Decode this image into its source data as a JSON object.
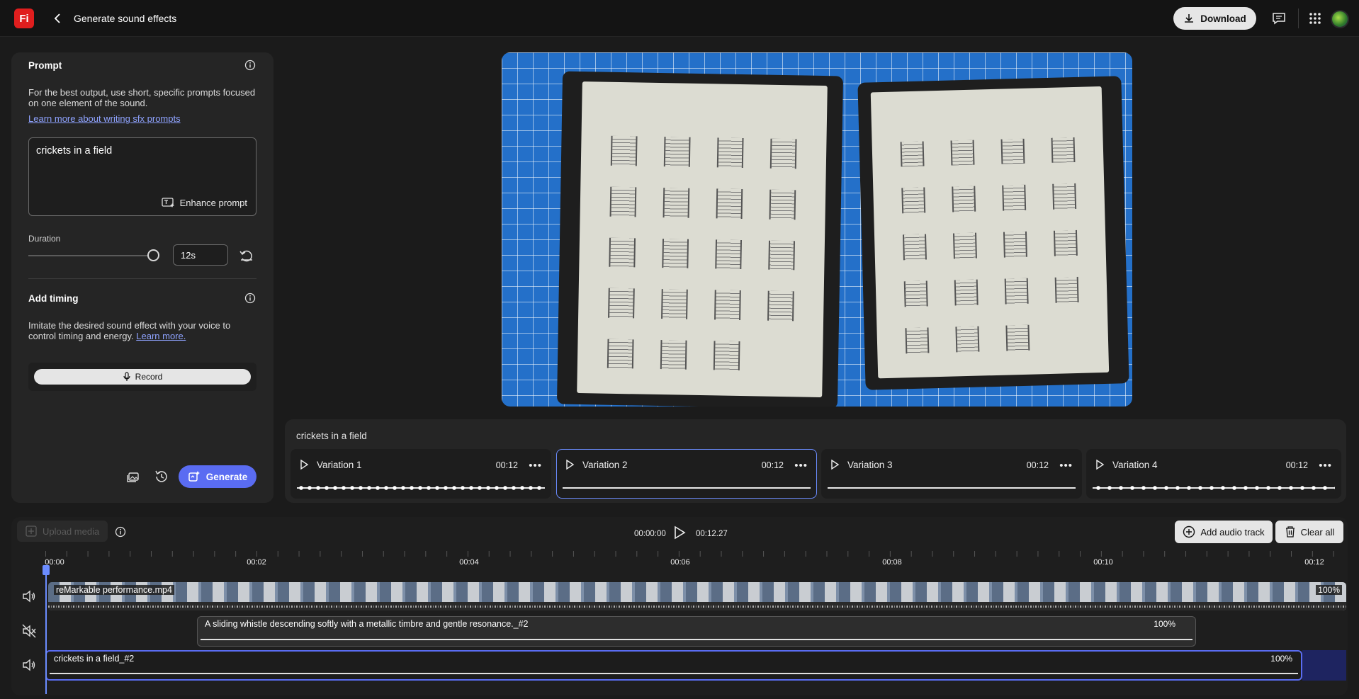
{
  "header": {
    "logo_text": "Fi",
    "title": "Generate sound effects",
    "download_label": "Download",
    "icons": [
      "back-icon",
      "download-icon",
      "comment-icon",
      "apps-grid-icon",
      "avatar"
    ]
  },
  "prompt_panel": {
    "heading": "Prompt",
    "description": "For the best output, use short, specific prompts focused on one element of the sound.",
    "learn_link": "Learn more about writing sfx prompts",
    "prompt_value": "crickets in a field",
    "enhance_label": "Enhance prompt",
    "duration_label": "Duration",
    "duration_value": "12s",
    "duration_slider_fraction": 1.0,
    "timing_heading": "Add timing",
    "timing_desc": "Imitate the desired sound effect with your voice to control timing and energy.",
    "timing_link": "Learn more.",
    "record_label": "Record",
    "generate_label": "Generate"
  },
  "variations": {
    "prompt_title": "crickets in a field",
    "items": [
      {
        "name": "Variation 1",
        "duration": "00:12",
        "selected": false
      },
      {
        "name": "Variation 2",
        "duration": "00:12",
        "selected": true
      },
      {
        "name": "Variation 3",
        "duration": "00:12",
        "selected": false
      },
      {
        "name": "Variation 4",
        "duration": "00:12",
        "selected": false
      }
    ]
  },
  "timeline": {
    "upload_label": "Upload media",
    "current_time": "00:00:00",
    "total_time": "00:12.27",
    "add_track_label": "Add audio track",
    "clear_all_label": "Clear all",
    "ticks": [
      "00:00",
      "00:02",
      "00:04",
      "00:06",
      "00:08",
      "00:10",
      "00:12"
    ],
    "tracks": [
      {
        "name": "reMarkable performance.mp4",
        "volume": "100%",
        "muted": false
      },
      {
        "name": "A sliding whistle descending softly with a metallic timbre and gentle resonance._#2",
        "volume": "100%",
        "muted": true
      },
      {
        "name": "crickets in a field_#2",
        "volume": "100%",
        "muted": false
      }
    ]
  },
  "colors": {
    "accent": "#5a6cf2",
    "selection_border": "#6b8cff",
    "logo_red": "#e01e1e"
  }
}
